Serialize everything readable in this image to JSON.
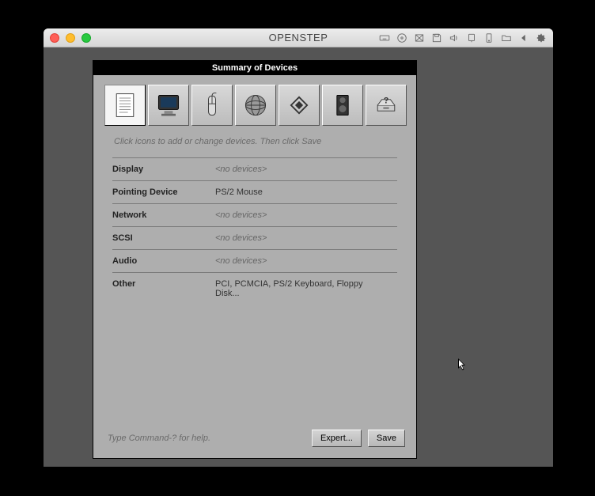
{
  "window": {
    "title": "OPENSTEP"
  },
  "app": {
    "title": "Summary of Devices",
    "hint": "Click icons to add or change devices.  Then click Save",
    "help": "Type Command-? for help.",
    "buttons": {
      "expert": "Expert...",
      "save": "Save"
    }
  },
  "categories": [
    {
      "label": "Display",
      "value": "<no devices>",
      "empty": true
    },
    {
      "label": "Pointing Device",
      "value": "PS/2 Mouse",
      "empty": false
    },
    {
      "label": "Network",
      "value": "<no devices>",
      "empty": true
    },
    {
      "label": "SCSI",
      "value": "<no devices>",
      "empty": true
    },
    {
      "label": "Audio",
      "value": "<no devices>",
      "empty": true
    },
    {
      "label": "Other",
      "value": "PCI, PCMCIA, PS/2 Keyboard, Floppy Disk...",
      "empty": false
    }
  ],
  "toolbar_icons": [
    "keyboard",
    "disc",
    "save",
    "floppy",
    "volume",
    "phone",
    "tablet",
    "folder",
    "back",
    "gear"
  ]
}
